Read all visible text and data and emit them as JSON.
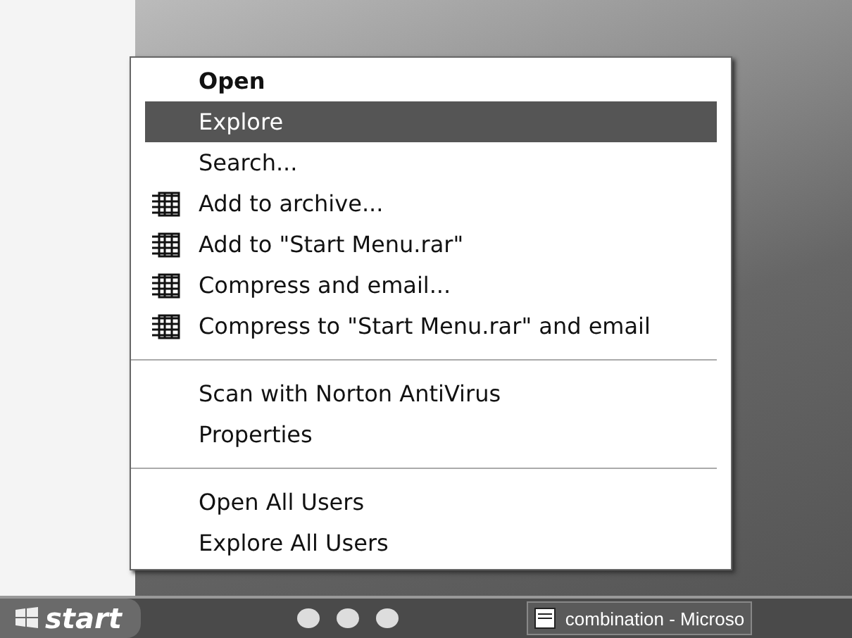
{
  "context_menu": {
    "items": [
      {
        "kind": "item",
        "label": "Open",
        "default": true,
        "selected": false,
        "icon": false
      },
      {
        "kind": "item",
        "label": "Explore",
        "default": false,
        "selected": true,
        "icon": false
      },
      {
        "kind": "item",
        "label": "Search...",
        "default": false,
        "selected": false,
        "icon": false
      },
      {
        "kind": "item",
        "label": "Add to archive...",
        "default": false,
        "selected": false,
        "icon": true
      },
      {
        "kind": "item",
        "label": "Add to \"Start Menu.rar\"",
        "default": false,
        "selected": false,
        "icon": true
      },
      {
        "kind": "item",
        "label": "Compress and email...",
        "default": false,
        "selected": false,
        "icon": true
      },
      {
        "kind": "item",
        "label": "Compress to \"Start Menu.rar\" and email",
        "default": false,
        "selected": false,
        "icon": true
      },
      {
        "kind": "separator"
      },
      {
        "kind": "item",
        "label": "Scan with Norton AntiVirus",
        "default": false,
        "selected": false,
        "icon": false
      },
      {
        "kind": "item",
        "label": "Properties",
        "default": false,
        "selected": false,
        "icon": false
      },
      {
        "kind": "separator"
      },
      {
        "kind": "item",
        "label": "Open All Users",
        "default": false,
        "selected": false,
        "icon": false
      },
      {
        "kind": "item",
        "label": "Explore All Users",
        "default": false,
        "selected": false,
        "icon": false
      }
    ]
  },
  "taskbar": {
    "start_label": "start",
    "buttons": [
      {
        "label": "combination - Microso"
      }
    ]
  }
}
